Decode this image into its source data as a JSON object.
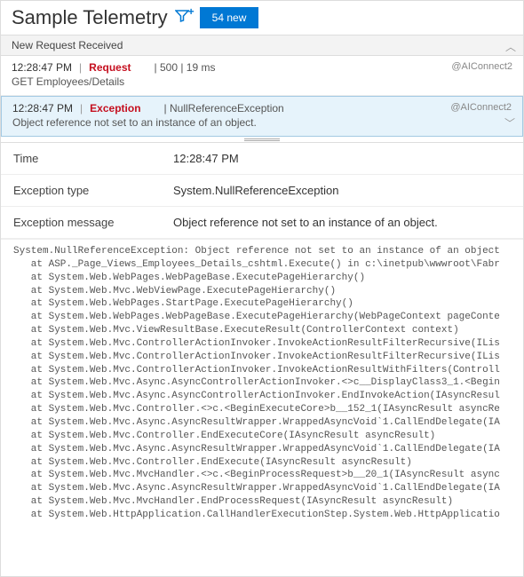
{
  "header": {
    "title": "Sample Telemetry",
    "new_button_label": "54 new"
  },
  "section_label": "New Request Received",
  "entries": [
    {
      "timestamp": "12:28:47 PM",
      "kind": "Request",
      "meta": "| 500 | 19 ms",
      "sub": "GET Employees/Details",
      "source": "@AIConnect2",
      "selected": false
    },
    {
      "timestamp": "12:28:47 PM",
      "kind": "Exception",
      "meta": "| NullReferenceException",
      "sub": "Object reference not set to an instance of an object.",
      "source": "@AIConnect2",
      "selected": true
    }
  ],
  "details": {
    "rows": [
      {
        "key": "Time",
        "val": "12:28:47 PM"
      },
      {
        "key": "Exception type",
        "val": "System.NullReferenceException"
      },
      {
        "key": "Exception message",
        "val": "Object reference not set to an instance of an object."
      }
    ]
  },
  "stack_trace": "System.NullReferenceException: Object reference not set to an instance of an object\n   at ASP._Page_Views_Employees_Details_cshtml.Execute() in c:\\inetpub\\wwwroot\\Fabr\n   at System.Web.WebPages.WebPageBase.ExecutePageHierarchy()\n   at System.Web.Mvc.WebViewPage.ExecutePageHierarchy()\n   at System.Web.WebPages.StartPage.ExecutePageHierarchy()\n   at System.Web.WebPages.WebPageBase.ExecutePageHierarchy(WebPageContext pageConte\n   at System.Web.Mvc.ViewResultBase.ExecuteResult(ControllerContext context)\n   at System.Web.Mvc.ControllerActionInvoker.InvokeActionResultFilterRecursive(ILis\n   at System.Web.Mvc.ControllerActionInvoker.InvokeActionResultFilterRecursive(ILis\n   at System.Web.Mvc.ControllerActionInvoker.InvokeActionResultWithFilters(Controll\n   at System.Web.Mvc.Async.AsyncControllerActionInvoker.<>c__DisplayClass3_1.<Begin\n   at System.Web.Mvc.Async.AsyncControllerActionInvoker.EndInvokeAction(IAsyncResul\n   at System.Web.Mvc.Controller.<>c.<BeginExecuteCore>b__152_1(IAsyncResult asyncRe\n   at System.Web.Mvc.Async.AsyncResultWrapper.WrappedAsyncVoid`1.CallEndDelegate(IA\n   at System.Web.Mvc.Controller.EndExecuteCore(IAsyncResult asyncResult)\n   at System.Web.Mvc.Async.AsyncResultWrapper.WrappedAsyncVoid`1.CallEndDelegate(IA\n   at System.Web.Mvc.Controller.EndExecute(IAsyncResult asyncResult)\n   at System.Web.Mvc.MvcHandler.<>c.<BeginProcessRequest>b__20_1(IAsyncResult async\n   at System.Web.Mvc.Async.AsyncResultWrapper.WrappedAsyncVoid`1.CallEndDelegate(IA\n   at System.Web.Mvc.MvcHandler.EndProcessRequest(IAsyncResult asyncResult)\n   at System.Web.HttpApplication.CallHandlerExecutionStep.System.Web.HttpApplicatio\n   at System.Web.HttpApplication.ExecuteStep(IExecutionStep step, Boolean& complete"
}
